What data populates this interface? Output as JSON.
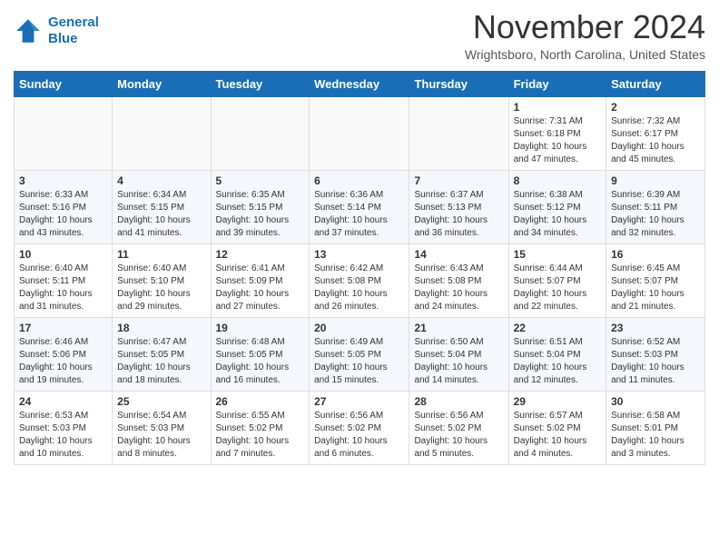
{
  "header": {
    "logo_line1": "General",
    "logo_line2": "Blue",
    "month": "November 2024",
    "location": "Wrightsboro, North Carolina, United States"
  },
  "weekdays": [
    "Sunday",
    "Monday",
    "Tuesday",
    "Wednesday",
    "Thursday",
    "Friday",
    "Saturday"
  ],
  "weeks": [
    [
      {
        "day": "",
        "info": ""
      },
      {
        "day": "",
        "info": ""
      },
      {
        "day": "",
        "info": ""
      },
      {
        "day": "",
        "info": ""
      },
      {
        "day": "",
        "info": ""
      },
      {
        "day": "1",
        "info": "Sunrise: 7:31 AM\nSunset: 6:18 PM\nDaylight: 10 hours\nand 47 minutes."
      },
      {
        "day": "2",
        "info": "Sunrise: 7:32 AM\nSunset: 6:17 PM\nDaylight: 10 hours\nand 45 minutes."
      }
    ],
    [
      {
        "day": "3",
        "info": "Sunrise: 6:33 AM\nSunset: 5:16 PM\nDaylight: 10 hours\nand 43 minutes."
      },
      {
        "day": "4",
        "info": "Sunrise: 6:34 AM\nSunset: 5:15 PM\nDaylight: 10 hours\nand 41 minutes."
      },
      {
        "day": "5",
        "info": "Sunrise: 6:35 AM\nSunset: 5:15 PM\nDaylight: 10 hours\nand 39 minutes."
      },
      {
        "day": "6",
        "info": "Sunrise: 6:36 AM\nSunset: 5:14 PM\nDaylight: 10 hours\nand 37 minutes."
      },
      {
        "day": "7",
        "info": "Sunrise: 6:37 AM\nSunset: 5:13 PM\nDaylight: 10 hours\nand 36 minutes."
      },
      {
        "day": "8",
        "info": "Sunrise: 6:38 AM\nSunset: 5:12 PM\nDaylight: 10 hours\nand 34 minutes."
      },
      {
        "day": "9",
        "info": "Sunrise: 6:39 AM\nSunset: 5:11 PM\nDaylight: 10 hours\nand 32 minutes."
      }
    ],
    [
      {
        "day": "10",
        "info": "Sunrise: 6:40 AM\nSunset: 5:11 PM\nDaylight: 10 hours\nand 31 minutes."
      },
      {
        "day": "11",
        "info": "Sunrise: 6:40 AM\nSunset: 5:10 PM\nDaylight: 10 hours\nand 29 minutes."
      },
      {
        "day": "12",
        "info": "Sunrise: 6:41 AM\nSunset: 5:09 PM\nDaylight: 10 hours\nand 27 minutes."
      },
      {
        "day": "13",
        "info": "Sunrise: 6:42 AM\nSunset: 5:08 PM\nDaylight: 10 hours\nand 26 minutes."
      },
      {
        "day": "14",
        "info": "Sunrise: 6:43 AM\nSunset: 5:08 PM\nDaylight: 10 hours\nand 24 minutes."
      },
      {
        "day": "15",
        "info": "Sunrise: 6:44 AM\nSunset: 5:07 PM\nDaylight: 10 hours\nand 22 minutes."
      },
      {
        "day": "16",
        "info": "Sunrise: 6:45 AM\nSunset: 5:07 PM\nDaylight: 10 hours\nand 21 minutes."
      }
    ],
    [
      {
        "day": "17",
        "info": "Sunrise: 6:46 AM\nSunset: 5:06 PM\nDaylight: 10 hours\nand 19 minutes."
      },
      {
        "day": "18",
        "info": "Sunrise: 6:47 AM\nSunset: 5:05 PM\nDaylight: 10 hours\nand 18 minutes."
      },
      {
        "day": "19",
        "info": "Sunrise: 6:48 AM\nSunset: 5:05 PM\nDaylight: 10 hours\nand 16 minutes."
      },
      {
        "day": "20",
        "info": "Sunrise: 6:49 AM\nSunset: 5:05 PM\nDaylight: 10 hours\nand 15 minutes."
      },
      {
        "day": "21",
        "info": "Sunrise: 6:50 AM\nSunset: 5:04 PM\nDaylight: 10 hours\nand 14 minutes."
      },
      {
        "day": "22",
        "info": "Sunrise: 6:51 AM\nSunset: 5:04 PM\nDaylight: 10 hours\nand 12 minutes."
      },
      {
        "day": "23",
        "info": "Sunrise: 6:52 AM\nSunset: 5:03 PM\nDaylight: 10 hours\nand 11 minutes."
      }
    ],
    [
      {
        "day": "24",
        "info": "Sunrise: 6:53 AM\nSunset: 5:03 PM\nDaylight: 10 hours\nand 10 minutes."
      },
      {
        "day": "25",
        "info": "Sunrise: 6:54 AM\nSunset: 5:03 PM\nDaylight: 10 hours\nand 8 minutes."
      },
      {
        "day": "26",
        "info": "Sunrise: 6:55 AM\nSunset: 5:02 PM\nDaylight: 10 hours\nand 7 minutes."
      },
      {
        "day": "27",
        "info": "Sunrise: 6:56 AM\nSunset: 5:02 PM\nDaylight: 10 hours\nand 6 minutes."
      },
      {
        "day": "28",
        "info": "Sunrise: 6:56 AM\nSunset: 5:02 PM\nDaylight: 10 hours\nand 5 minutes."
      },
      {
        "day": "29",
        "info": "Sunrise: 6:57 AM\nSunset: 5:02 PM\nDaylight: 10 hours\nand 4 minutes."
      },
      {
        "day": "30",
        "info": "Sunrise: 6:58 AM\nSunset: 5:01 PM\nDaylight: 10 hours\nand 3 minutes."
      }
    ]
  ]
}
